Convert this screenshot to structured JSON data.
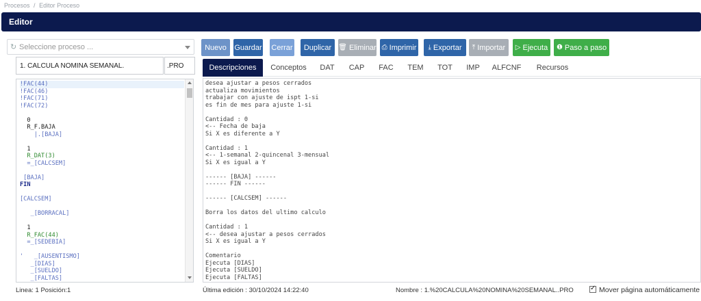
{
  "breadcrumb": [
    "Procesos",
    "/",
    "Editor Proceso"
  ],
  "header": {
    "title": "Editor"
  },
  "left": {
    "select_placeholder": "Seleccione proceso ...",
    "name_value": "1. CALCULA NOMINA SEMANAL.",
    "ext_value": ".PRO"
  },
  "code_lines": [
    {
      "t": "!FAC(44)",
      "c": "blue",
      "hl": true
    },
    {
      "t": "!FAC(46)",
      "c": "blue"
    },
    {
      "t": "!FAC(71)",
      "c": "blue"
    },
    {
      "t": "!FAC(72)",
      "c": "blue"
    },
    {
      "t": "",
      "c": ""
    },
    {
      "t": "  0",
      "c": "dark"
    },
    {
      "t": "  R_F.BAJA",
      "c": "dark"
    },
    {
      "t": "    |.[BAJA]",
      "c": "blue"
    },
    {
      "t": "",
      "c": ""
    },
    {
      "t": "  1",
      "c": "dark"
    },
    {
      "t": "  R_DAT(3)",
      "c": "green"
    },
    {
      "t": "  =_[CALCSEM]",
      "c": "blue"
    },
    {
      "t": "",
      "c": ""
    },
    {
      "t": " [BAJA]",
      "c": "blue"
    },
    {
      "t": "FIN",
      "c": "bold"
    },
    {
      "t": "",
      "c": ""
    },
    {
      "t": "[CALCSEM]",
      "c": "blue"
    },
    {
      "t": "",
      "c": ""
    },
    {
      "t": "   _[BORRACAL]",
      "c": "blue"
    },
    {
      "t": "",
      "c": ""
    },
    {
      "t": "  1",
      "c": "dark"
    },
    {
      "t": "  R_FAC(44)",
      "c": "green"
    },
    {
      "t": "  =_[SEDEBIA]",
      "c": "blue"
    },
    {
      "t": "",
      "c": ""
    },
    {
      "t": "'   _[AUSENTISMO]",
      "c": "blue"
    },
    {
      "t": "   _[DIAS]",
      "c": "blue"
    },
    {
      "t": "   _[SUELDO]",
      "c": "blue"
    },
    {
      "t": "   _[FALTAS]",
      "c": "blue"
    }
  ],
  "toolbar": {
    "nuevo": "Nuevo",
    "guardar": "Guardar",
    "cerrar": "Cerrar",
    "duplicar": "Duplicar",
    "eliminar": "Eliminar",
    "imprimir": "Imprimir",
    "exportar": "Exportar",
    "importar": "Importar",
    "ejecuta": "Ejecuta",
    "paso": "Paso a paso"
  },
  "tabs": [
    "Descripciones",
    "Conceptos",
    "DAT",
    "CAP",
    "FAC",
    "TEM",
    "TOT",
    "IMP",
    "ALFCNF",
    "Recursos"
  ],
  "desc_lines": [
    "desea ajustar a pesos cerrados",
    "actualiza movimientos",
    "trabajar con ajuste de ispt 1-si",
    "es fin de mes para ajuste 1-si",
    "",
    "Cantidad : 0",
    "<-- Fecha de baja",
    "Si X es diferente a Y",
    "",
    "Cantidad : 1",
    "<-- 1-semanal 2-quincenal 3-mensual",
    "Si X es igual a Y",
    "",
    "------ [BAJA] ------",
    "------ FIN ------",
    "",
    "------ [CALCSEM] ------",
    "",
    "Borra los datos del ultimo calculo",
    "",
    "Cantidad : 1",
    "<-- desea ajustar a pesos cerrados",
    "Si X es igual a Y",
    "",
    "Comentario",
    "Ejecuta [DIAS]",
    "Ejecuta [SUELDO]",
    "Ejecuta [FALTAS]"
  ],
  "status": {
    "linea": "Linea: 1 Posición:1",
    "ultima": "Última edición : 30/10/2024 14:22:40",
    "nombre": "Nombre : 1.%20CALCULA%20NOMINA%20SEMANAL..PRO",
    "mover": "Mover página automáticamente"
  }
}
